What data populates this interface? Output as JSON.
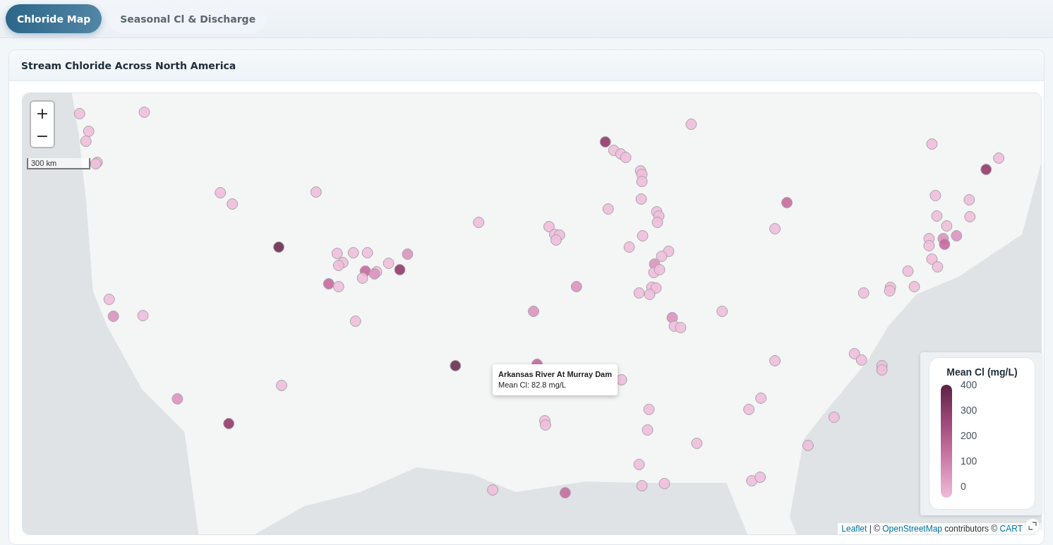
{
  "tabs": [
    {
      "label": "Chloride Map",
      "selected": true
    },
    {
      "label": "Seasonal Cl & Discharge",
      "selected": false
    }
  ],
  "card": {
    "title": "Stream Chloride Across North America"
  },
  "map": {
    "zoom_in": "+",
    "zoom_out": "−",
    "scale": "300 km",
    "tooltip": {
      "title": "Arkansas River At Murray Dam",
      "text": "Mean Cl: 82.8 mg/L"
    },
    "legend": {
      "title": "Mean Cl (mg/L)",
      "ticks": [
        "400",
        "300",
        "200",
        "100",
        "0"
      ]
    },
    "attribution": [
      {
        "kind": "link",
        "text": "Leaflet"
      },
      {
        "kind": "text",
        "text": " | © "
      },
      {
        "kind": "link",
        "text": "OpenStreetMap"
      },
      {
        "kind": "text",
        "text": " contributors © "
      },
      {
        "kind": "link",
        "text": "CART"
      }
    ]
  }
}
